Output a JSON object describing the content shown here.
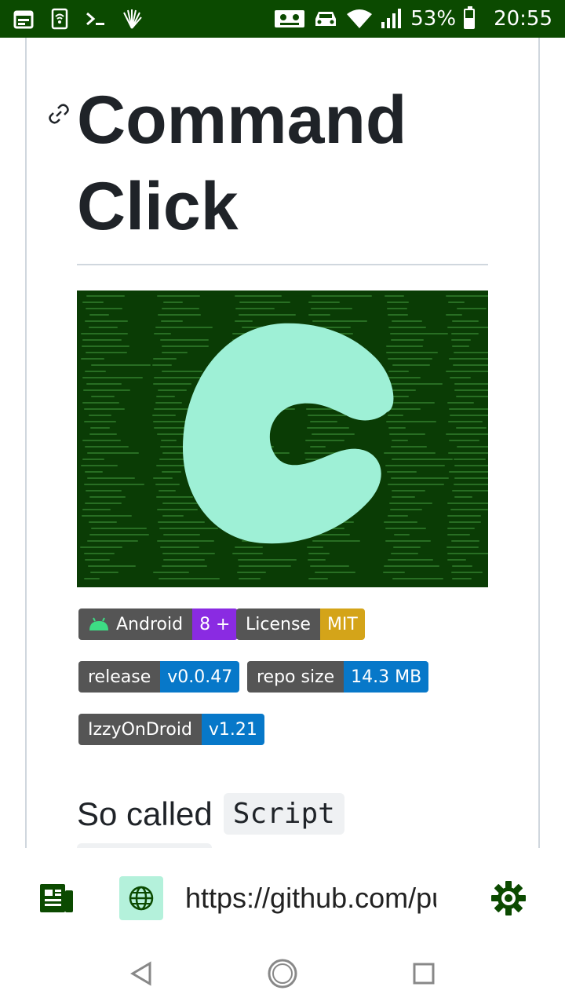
{
  "status_bar": {
    "battery_percent": "53%",
    "battery_level": 0.53,
    "time": "20:55",
    "left_icons": [
      "calendar-icon",
      "wifi-file-icon",
      "terminal-icon",
      "fan-icon"
    ],
    "right_icons": [
      "sim-card-icon",
      "car-icon",
      "wifi-icon",
      "signal-icon",
      "battery-icon"
    ]
  },
  "page": {
    "heading": "Command Click",
    "badges": [
      {
        "label": "Android",
        "value": "8 +",
        "value_color": "#8a2be2",
        "icon": "android-icon"
      },
      {
        "label": "License",
        "value": "MIT",
        "value_color": "#d4a419"
      },
      {
        "label": "release",
        "value": "v0.0.47",
        "value_color": "#0778c9"
      },
      {
        "label": "repo size",
        "value": "14.3 MB",
        "value_color": "#0778c9"
      },
      {
        "label": "IzzyOnDroid",
        "value": "v1.21",
        "value_color": "#0778c9"
      }
    ],
    "paragraph_text": "So called",
    "paragraph_code": "Script"
  },
  "toolbar": {
    "url": "https://github.com/puutaro/CommandClick",
    "icons": [
      "reader-icon",
      "globe-icon",
      "settings-gear-icon"
    ]
  },
  "navbar": {
    "icons": [
      "back-triangle-icon",
      "home-circle-icon",
      "recents-square-icon"
    ]
  },
  "colors": {
    "status_bar_bg": "#0b4a00",
    "logo_color": "#9ef0d6",
    "banner_bg": "#0a3c05",
    "toolbar_icon": "#0b4a00"
  }
}
